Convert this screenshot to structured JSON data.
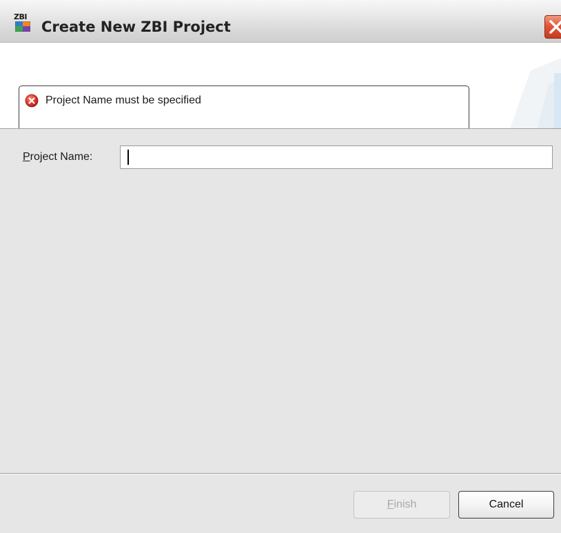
{
  "window": {
    "title": "Create New ZBI Project",
    "app_icon_text": "ZBI",
    "close_icon": "close-icon"
  },
  "header": {
    "message": "Project Name must be specified",
    "message_icon": "error-icon"
  },
  "form": {
    "project_name_label_mnemonic": "P",
    "project_name_label_rest": "roject Name:",
    "project_name_value": ""
  },
  "footer": {
    "finish_mnemonic": "F",
    "finish_rest": "inish",
    "finish_enabled": false,
    "cancel_label": "Cancel"
  },
  "colors": {
    "title_bar": "#d9d9d9",
    "close_button": "#e2553b",
    "error_red": "#d9342b",
    "dialog_background": "#e6e6e6",
    "header_background": "#ffffff"
  }
}
